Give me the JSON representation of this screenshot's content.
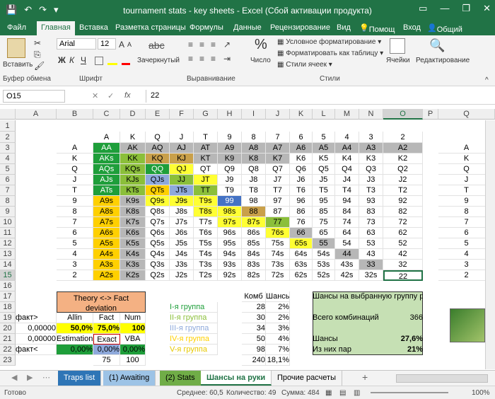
{
  "window": {
    "title": "tournament stats - key sheets - Excel (Сбой активации продукта)",
    "minimize": "—",
    "restore": "❐",
    "close": "✕",
    "ribbon_toggle": "▭"
  },
  "quick_access": {
    "save": "💾",
    "undo": "↶",
    "redo": "↷",
    "more": "▾"
  },
  "tabs": [
    "Файл",
    "Главная",
    "Вставка",
    "Разметка страницы",
    "Формулы",
    "Данные",
    "Рецензирование",
    "Вид"
  ],
  "tell_me": "Помощ",
  "login": "Вход",
  "share": "Общий доступ",
  "ribbon": {
    "paste": "Вставить",
    "font_name": "Arial",
    "font_size": "12",
    "font_grow": "A",
    "font_shrink": "A",
    "bold": "Ж",
    "italic": "К",
    "underline": "Ч",
    "clipboard_label": "Буфер обмена",
    "font_label": "Шрифт",
    "strike_label": "Зачеркнутый",
    "strike_sample": "abc",
    "align_label": "Выравнивание",
    "number_label": "Число",
    "number_symbol": "%",
    "cond_format": "Условное форматирование",
    "format_table": "Форматировать как таблицу",
    "cell_styles": "Стили ячеек",
    "styles_label": "Стили",
    "cells_label": "Ячейки",
    "editing_label": "Редактирование",
    "collapse": "^"
  },
  "formula_bar": {
    "namebox": "O15",
    "cancel": "✕",
    "enter": "✓",
    "fx": "fx",
    "value": "22"
  },
  "columns": [
    "A",
    "B",
    "C",
    "D",
    "E",
    "F",
    "G",
    "H",
    "I",
    "J",
    "K",
    "L",
    "M",
    "N",
    "O",
    "P",
    "Q"
  ],
  "rows": [
    "1",
    "2",
    "3",
    "4",
    "5",
    "6",
    "7",
    "8",
    "9",
    "10",
    "11",
    "12",
    "13",
    "14",
    "15",
    "16",
    "17",
    "18",
    "19",
    "20",
    "21",
    "22",
    "23"
  ],
  "card_header": [
    "A",
    "K",
    "Q",
    "J",
    "T",
    "9",
    "8",
    "7",
    "6",
    "5",
    "4",
    "3",
    "2"
  ],
  "row_labels": [
    "A",
    "K",
    "Q",
    "J",
    "T",
    "9",
    "8",
    "7",
    "6",
    "5",
    "4",
    "3",
    "2"
  ],
  "matrix": [
    [
      "AA",
      "AK",
      "AQ",
      "AJ",
      "AT",
      "A9",
      "A8",
      "A7",
      "A6",
      "A5",
      "A4",
      "A3",
      "A2"
    ],
    [
      "AKs",
      "KK",
      "KQ",
      "KJ",
      "KT",
      "K9",
      "K8",
      "K7",
      "K6",
      "K5",
      "K4",
      "K3",
      "K2"
    ],
    [
      "AQs",
      "KQs",
      "QQ",
      "QJ",
      "QT",
      "Q9",
      "Q8",
      "Q7",
      "Q6",
      "Q5",
      "Q4",
      "Q3",
      "Q2"
    ],
    [
      "AJs",
      "KJs",
      "QJs",
      "JJ",
      "JT",
      "J9",
      "J8",
      "J7",
      "J6",
      "J5",
      "J4",
      "J3",
      "J2"
    ],
    [
      "ATs",
      "KTs",
      "QTs",
      "JTs",
      "TT",
      "T9",
      "T8",
      "T7",
      "T6",
      "T5",
      "T4",
      "T3",
      "T2"
    ],
    [
      "A9s",
      "K9s",
      "Q9s",
      "J9s",
      "T9s",
      "99",
      "98",
      "97",
      "96",
      "95",
      "94",
      "93",
      "92"
    ],
    [
      "A8s",
      "K8s",
      "Q8s",
      "J8s",
      "T8s",
      "98s",
      "88",
      "87",
      "86",
      "85",
      "84",
      "83",
      "82"
    ],
    [
      "A7s",
      "K7s",
      "Q7s",
      "J7s",
      "T7s",
      "97s",
      "87s",
      "77",
      "76",
      "75",
      "74",
      "73",
      "72"
    ],
    [
      "A6s",
      "K6s",
      "Q6s",
      "J6s",
      "T6s",
      "96s",
      "86s",
      "76s",
      "66",
      "65",
      "64",
      "63",
      "62"
    ],
    [
      "A5s",
      "K5s",
      "Q5s",
      "J5s",
      "T5s",
      "95s",
      "85s",
      "75s",
      "65s",
      "55",
      "54",
      "53",
      "52"
    ],
    [
      "A4s",
      "K4s",
      "Q4s",
      "J4s",
      "T4s",
      "94s",
      "84s",
      "74s",
      "64s",
      "54s",
      "44",
      "43",
      "42"
    ],
    [
      "A3s",
      "K3s",
      "Q3s",
      "J3s",
      "T3s",
      "93s",
      "83s",
      "73s",
      "63s",
      "53s",
      "43s",
      "33",
      "32"
    ],
    [
      "A2s",
      "K2s",
      "Q2s",
      "J2s",
      "T2s",
      "92s",
      "82s",
      "72s",
      "62s",
      "52s",
      "42s",
      "32s",
      "22"
    ]
  ],
  "colors": {
    "g1": "#1e9e3a",
    "g2": "#8bbf3a",
    "g3": "#8ea9db",
    "g4": "#ffd000",
    "g5": "#ffff33",
    "gray": "#b7b7b7",
    "blue": "#4472c4",
    "brown": "#c9a04a",
    "orange": "#f4b183",
    "lightgreen": "#c6e0b4",
    "excel": "#217346"
  },
  "theory": {
    "title": "Theory <-> Fact deviation",
    "h": [
      "Allin",
      "Fact",
      "Num"
    ],
    "r1": [
      "50,0%",
      "75,0%",
      "100"
    ],
    "r2": [
      "Estimation",
      "Exact",
      "VBA"
    ],
    "r3": [
      "0,00%",
      "0,00%",
      "0,00%"
    ],
    "r4": [
      "75",
      "100"
    ]
  },
  "left_labels": {
    "a19": "факт>",
    "a20": "0,00000",
    "a21": "0,00000",
    "a22": "факт<"
  },
  "groups": {
    "h_comb": "Комб",
    "h_chance": "Шансы",
    "items": [
      {
        "name": "I-я группа",
        "comb": "28",
        "pct": "2%"
      },
      {
        "name": "II-я группа",
        "comb": "30",
        "pct": "2%"
      },
      {
        "name": "III-я группа",
        "comb": "34",
        "pct": "3%"
      },
      {
        "name": "IV-я группа",
        "comb": "50",
        "pct": "4%"
      },
      {
        "name": "V-я группа",
        "comb": "98",
        "pct": "7%"
      }
    ],
    "total_comb": "240",
    "total_pct": "18,1%"
  },
  "chances": {
    "title": "Шансы на выбранную группу рук:",
    "total_label": "Всего комбинаций",
    "total": "366",
    "ch_label": "Шансы",
    "ch": "27,6%",
    "pairs_label": "Из них пар",
    "pairs": "21%"
  },
  "sheets": [
    "Traps list",
    "(1) Awaiting",
    "(2) Stats",
    "Шансы на руки",
    "Прочие расчеты"
  ],
  "sheet_nav": {
    "prev": "◀",
    "next": "▶",
    "add": "+",
    "more": "⋯"
  },
  "status": {
    "ready": "Готово",
    "avg": "Среднее: 60,5",
    "count": "Количество: 49",
    "sum": "Сумма: 484",
    "zoom": "100%"
  }
}
